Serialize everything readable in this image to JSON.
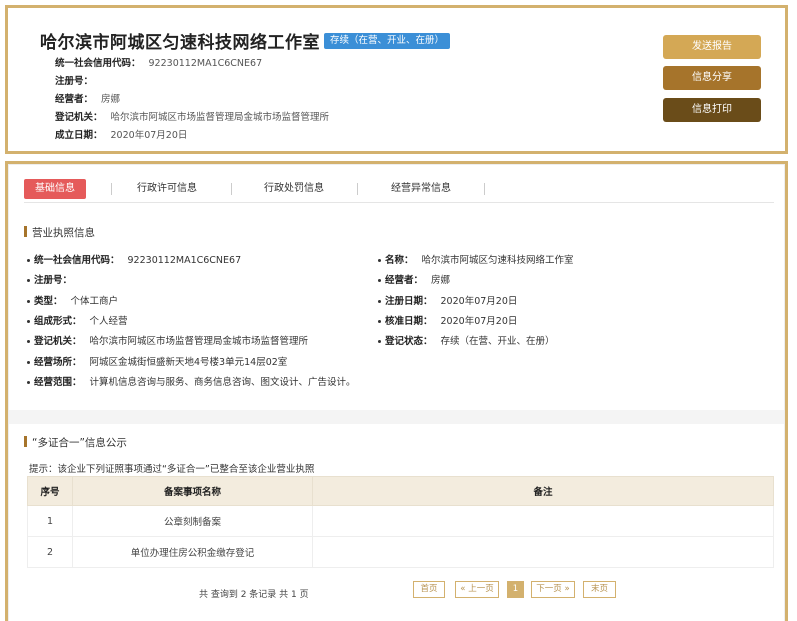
{
  "company": {
    "name": "哈尔滨市阿城区匀速科技网络工作室",
    "status_badge": "存续（在营、开业、在册）",
    "fields": [
      {
        "key": "统一社会信用代码：",
        "value": "92230112MA1C6CNE67"
      },
      {
        "key": "注册号：",
        "value": ""
      },
      {
        "key": "经营者：",
        "value": "房娜"
      },
      {
        "key": "登记机关：",
        "value": "哈尔滨市阿城区市场监督管理局金城市场监督管理所"
      },
      {
        "key": "成立日期：",
        "value": "2020年07月20日"
      }
    ]
  },
  "actions": {
    "send_report": "发送报告",
    "share": "信息分享",
    "print": "信息打印"
  },
  "tabs": [
    "基础信息",
    "行政许可信息",
    "行政处罚信息",
    "经营异常信息"
  ],
  "license": {
    "title": "营业执照信息",
    "left": [
      {
        "key": "统一社会信用代码：",
        "value": "92230112MA1C6CNE67"
      },
      {
        "key": "注册号：",
        "value": ""
      },
      {
        "key": "类型：",
        "value": "个体工商户"
      },
      {
        "key": "组成形式：",
        "value": "个人经营"
      },
      {
        "key": "登记机关：",
        "value": "哈尔滨市阿城区市场监督管理局金城市场监督管理所"
      },
      {
        "key": "经营场所：",
        "value": "阿城区金城街恒盛新天地4号楼3单元14层02室"
      },
      {
        "key": "经营范围：",
        "value": "计算机信息咨询与服务、商务信息咨询、图文设计、广告设计。"
      }
    ],
    "right": [
      {
        "key": "名称：",
        "value": "哈尔滨市阿城区匀速科技网络工作室"
      },
      {
        "key": "经营者：",
        "value": "房娜"
      },
      {
        "key": "注册日期：",
        "value": "2020年07月20日"
      },
      {
        "key": "核准日期：",
        "value": "2020年07月20日"
      },
      {
        "key": "登记状态：",
        "value": "存续（在营、开业、在册）"
      }
    ]
  },
  "multi": {
    "title": "“多证合一”信息公示",
    "hint": "提示：该企业下列证照事项通过“多证合一”已整合至该企业营业执照",
    "headers": [
      "序号",
      "备案事项名称",
      "备注"
    ],
    "rows": [
      {
        "no": "1",
        "name": "公章刻制备案",
        "note": ""
      },
      {
        "no": "2",
        "name": "单位办理住房公积金缴存登记",
        "note": ""
      }
    ]
  },
  "pager": {
    "info": "共 查询到 2 条记录 共 1 页",
    "first": "首页",
    "prev": "« 上一页",
    "current": "1",
    "next": "下一页 »",
    "last": "末页"
  }
}
